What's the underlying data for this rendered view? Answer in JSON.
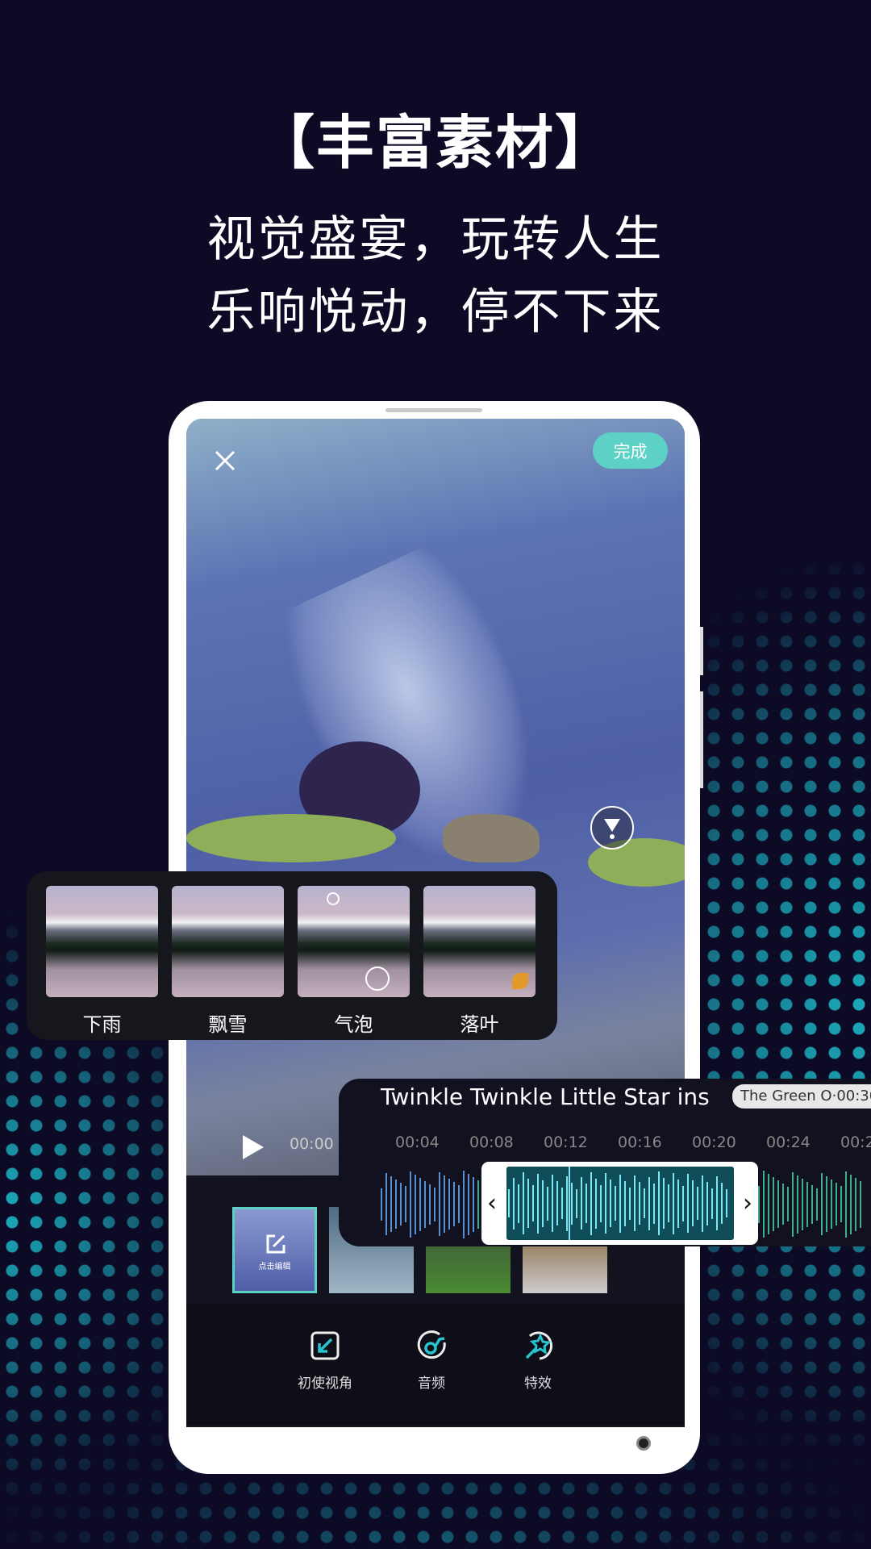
{
  "headline": "【丰富素材】",
  "subtitle_lines": [
    "视觉盛宴，玩转人生",
    "乐响悦动，停不下来"
  ],
  "editor": {
    "done_label": "完成",
    "close_icon": "close-icon",
    "playback_time": "00:00",
    "clip_edit_label": "点击编辑",
    "toolbar": [
      {
        "label": "初使视角",
        "icon": "crop-arrow-icon"
      },
      {
        "label": "音频",
        "icon": "music-note-icon"
      },
      {
        "label": "特效",
        "icon": "magic-wand-icon"
      }
    ]
  },
  "effects": [
    {
      "label": "下雨"
    },
    {
      "label": "飘雪"
    },
    {
      "label": "气泡"
    },
    {
      "label": "落叶"
    }
  ],
  "audio": {
    "song_title": "Twinkle Twinkle Little Star ins",
    "artist_duration": "The Green O·00:30",
    "ticks": [
      "00:04",
      "00:08",
      "00:12",
      "00:16",
      "00:20",
      "00:24",
      "00:2"
    ]
  },
  "colors": {
    "accent": "#5ed1c6",
    "background": "#0d0a26",
    "dots": "#1fc7d6"
  }
}
